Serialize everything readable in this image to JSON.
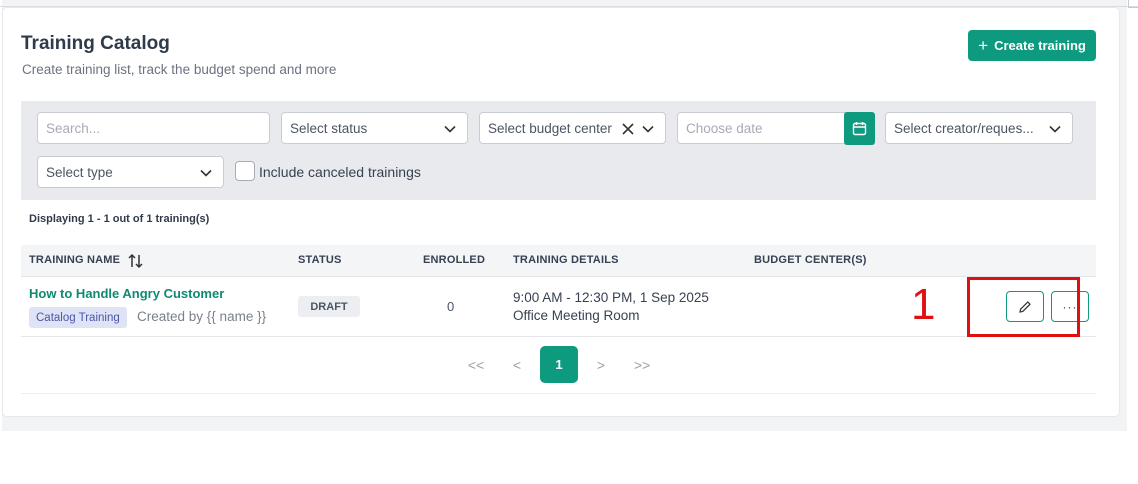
{
  "header": {
    "title": "Training Catalog",
    "subtitle": "Create training list, track the budget spend and more",
    "create_button": "Create training"
  },
  "filters": {
    "search_placeholder": "Search...",
    "status": "Select status",
    "budget_center": "Select budget center",
    "date_placeholder": "Choose date",
    "creator": "Select creator/reques...",
    "type": "Select type",
    "include_canceled": "Include canceled trainings"
  },
  "display_count": "Displaying 1 - 1 out of 1 training(s)",
  "table": {
    "columns": [
      "TRAINING NAME",
      "STATUS",
      "ENROLLED",
      "TRAINING DETAILS",
      "BUDGET CENTER(S)"
    ],
    "rows": [
      {
        "name": "How to Handle Angry Customer",
        "tag": "Catalog Training",
        "created_by": "Created by {{ name }}",
        "status": "DRAFT",
        "enrolled": "0",
        "time": "9:00 AM - 12:30 PM, 1 Sep 2025",
        "location": "Office Meeting Room",
        "budget_centers": ""
      }
    ]
  },
  "row_actions": {
    "more_label": "···"
  },
  "pagination": {
    "first": "<<",
    "prev": "<",
    "current": "1",
    "next": ">",
    "last": ">>"
  },
  "annotation": {
    "label": "1",
    "color": "#e01010"
  },
  "colors": {
    "accent": "#0e9a7e",
    "link": "#0e8a72",
    "tag_bg": "#dfe3f6"
  }
}
